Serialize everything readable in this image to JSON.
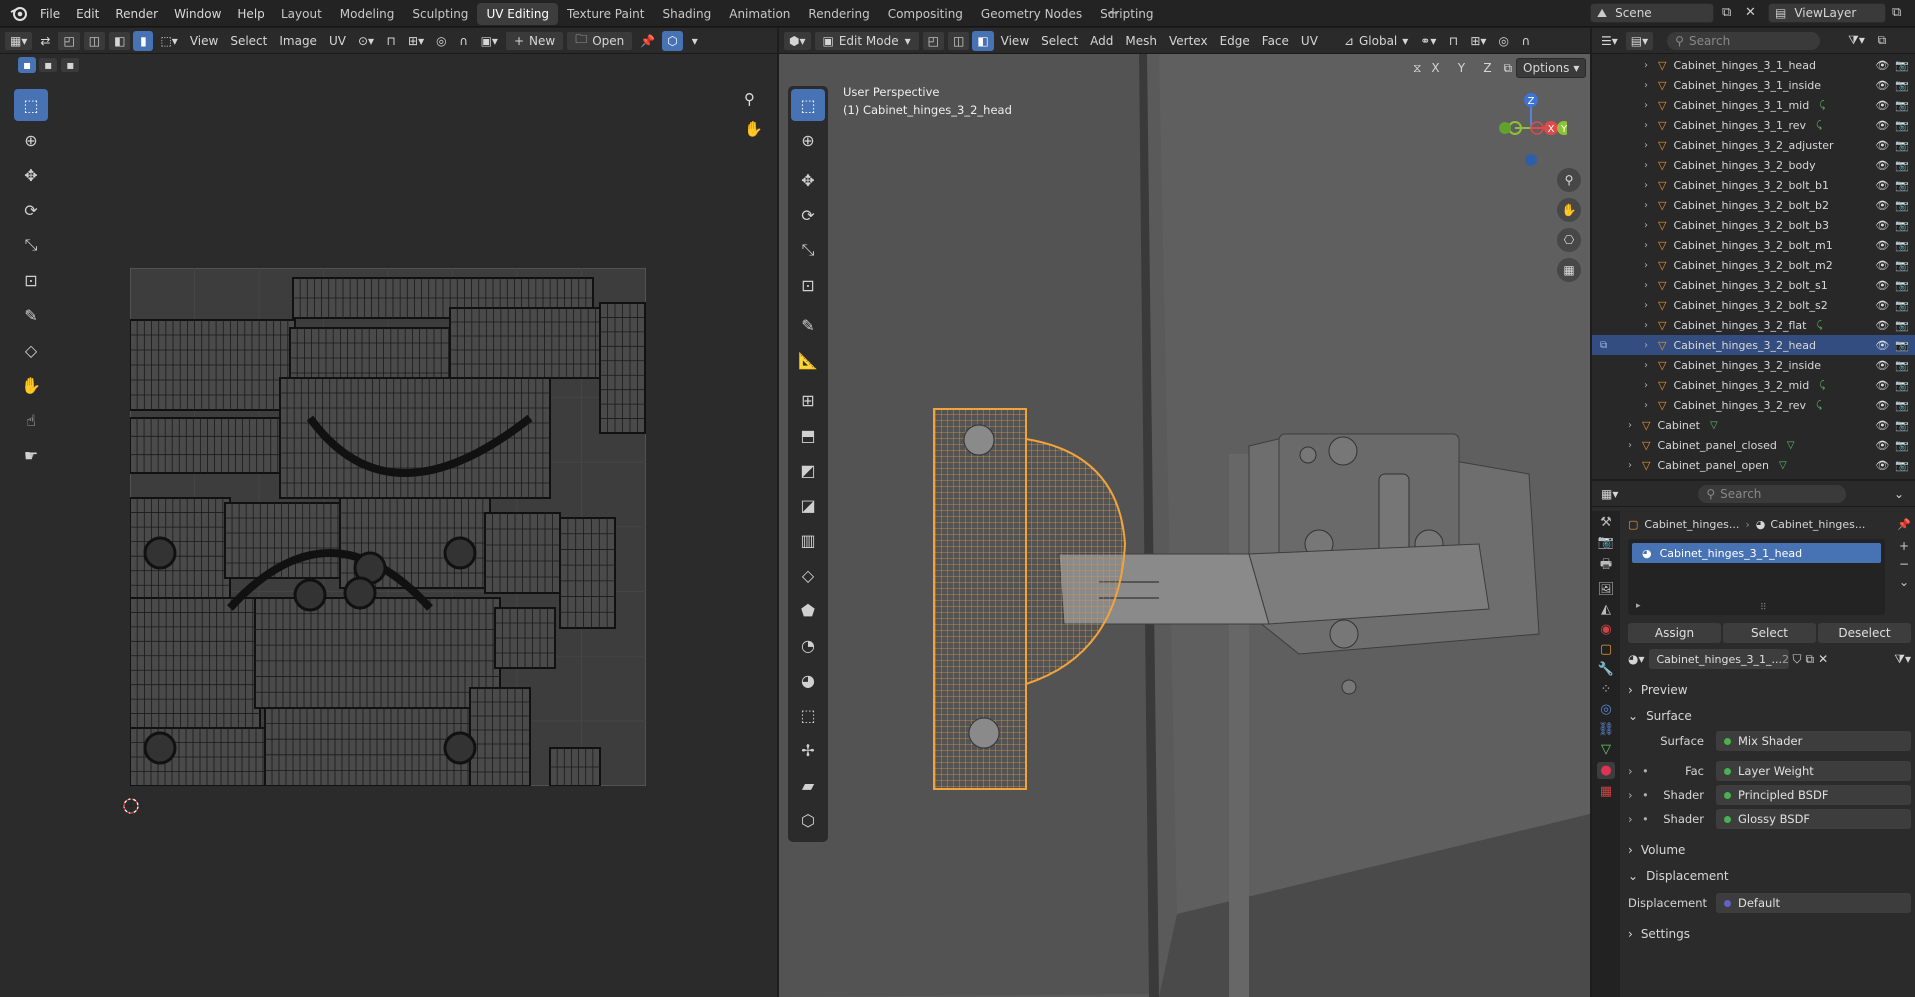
{
  "topmenu": [
    "File",
    "Edit",
    "Render",
    "Window",
    "Help"
  ],
  "workspaces": [
    "Layout",
    "Modeling",
    "Sculpting",
    "UV Editing",
    "Texture Paint",
    "Shading",
    "Animation",
    "Rendering",
    "Compositing",
    "Geometry Nodes",
    "Scripting"
  ],
  "active_workspace": "UV Editing",
  "scene": "Scene",
  "view_layer": "ViewLayer",
  "uv_header": {
    "menus": [
      "View",
      "Select",
      "Image",
      "UV"
    ],
    "new": "New",
    "open": "Open"
  },
  "vp_header": {
    "mode": "Edit Mode",
    "menus": [
      "View",
      "Select",
      "Add",
      "Mesh",
      "Vertex",
      "Edge",
      "Face",
      "UV"
    ],
    "orientation": "Global",
    "axes": [
      "X",
      "Y",
      "Z"
    ],
    "options": "Options"
  },
  "viewport": {
    "perspective": "User Perspective",
    "object": "(1) Cabinet_hinges_3_2_head",
    "gizmo": {
      "z": "Z",
      "x": "X",
      "y": "Y"
    }
  },
  "outliner": {
    "search": "Search",
    "items": [
      {
        "name": "Cabinet_hinges_3_1_head",
        "indent": 2,
        "extra": ""
      },
      {
        "name": "Cabinet_hinges_3_1_inside",
        "indent": 2,
        "extra": ""
      },
      {
        "name": "Cabinet_hinges_3_1_mid",
        "indent": 2,
        "extra": "curve"
      },
      {
        "name": "Cabinet_hinges_3_1_rev",
        "indent": 2,
        "extra": "curve"
      },
      {
        "name": "Cabinet_hinges_3_2_adjuster",
        "indent": 2,
        "extra": ""
      },
      {
        "name": "Cabinet_hinges_3_2_body",
        "indent": 2,
        "extra": ""
      },
      {
        "name": "Cabinet_hinges_3_2_bolt_b1",
        "indent": 2,
        "extra": ""
      },
      {
        "name": "Cabinet_hinges_3_2_bolt_b2",
        "indent": 2,
        "extra": ""
      },
      {
        "name": "Cabinet_hinges_3_2_bolt_b3",
        "indent": 2,
        "extra": ""
      },
      {
        "name": "Cabinet_hinges_3_2_bolt_m1",
        "indent": 2,
        "extra": ""
      },
      {
        "name": "Cabinet_hinges_3_2_bolt_m2",
        "indent": 2,
        "extra": ""
      },
      {
        "name": "Cabinet_hinges_3_2_bolt_s1",
        "indent": 2,
        "extra": ""
      },
      {
        "name": "Cabinet_hinges_3_2_bolt_s2",
        "indent": 2,
        "extra": ""
      },
      {
        "name": "Cabinet_hinges_3_2_flat",
        "indent": 2,
        "extra": "curve"
      },
      {
        "name": "Cabinet_hinges_3_2_head",
        "indent": 2,
        "extra": "",
        "selected": true
      },
      {
        "name": "Cabinet_hinges_3_2_inside",
        "indent": 2,
        "extra": ""
      },
      {
        "name": "Cabinet_hinges_3_2_mid",
        "indent": 2,
        "extra": "curve"
      },
      {
        "name": "Cabinet_hinges_3_2_rev",
        "indent": 2,
        "extra": "curve"
      },
      {
        "name": "Cabinet",
        "indent": 1,
        "extra": "mesh"
      },
      {
        "name": "Cabinet_panel_closed",
        "indent": 1,
        "extra": "mesh"
      },
      {
        "name": "Cabinet_panel_open",
        "indent": 1,
        "extra": "mesh"
      }
    ]
  },
  "properties": {
    "search": "Search",
    "breadcrumb": [
      "Cabinet_hinges...",
      "Cabinet_hinges..."
    ],
    "material_slot": "Cabinet_hinges_3_1_head",
    "buttons": [
      "Assign",
      "Select",
      "Deselect"
    ],
    "material_name": "Cabinet_hinges_3_1_...",
    "user_count": "2",
    "sections": {
      "preview": "Preview",
      "surface": "Surface",
      "volume": "Volume",
      "displacement": "Displacement",
      "settings": "Settings"
    },
    "surface_rows": [
      {
        "label": "Surface",
        "value": "Mix Shader",
        "color": "#4caf50"
      },
      {
        "label": "Fac",
        "value": "Layer Weight",
        "color": "#4caf50"
      },
      {
        "label": "Shader",
        "value": "Principled BSDF",
        "color": "#4caf50"
      },
      {
        "label": "Shader",
        "value": "Glossy BSDF",
        "color": "#4caf50"
      }
    ],
    "displacement_row": {
      "label": "Displacement",
      "value": "Default",
      "color": "#6363c7"
    }
  },
  "colors": {
    "accent": "#4772b3",
    "selection": "#e8962b"
  }
}
